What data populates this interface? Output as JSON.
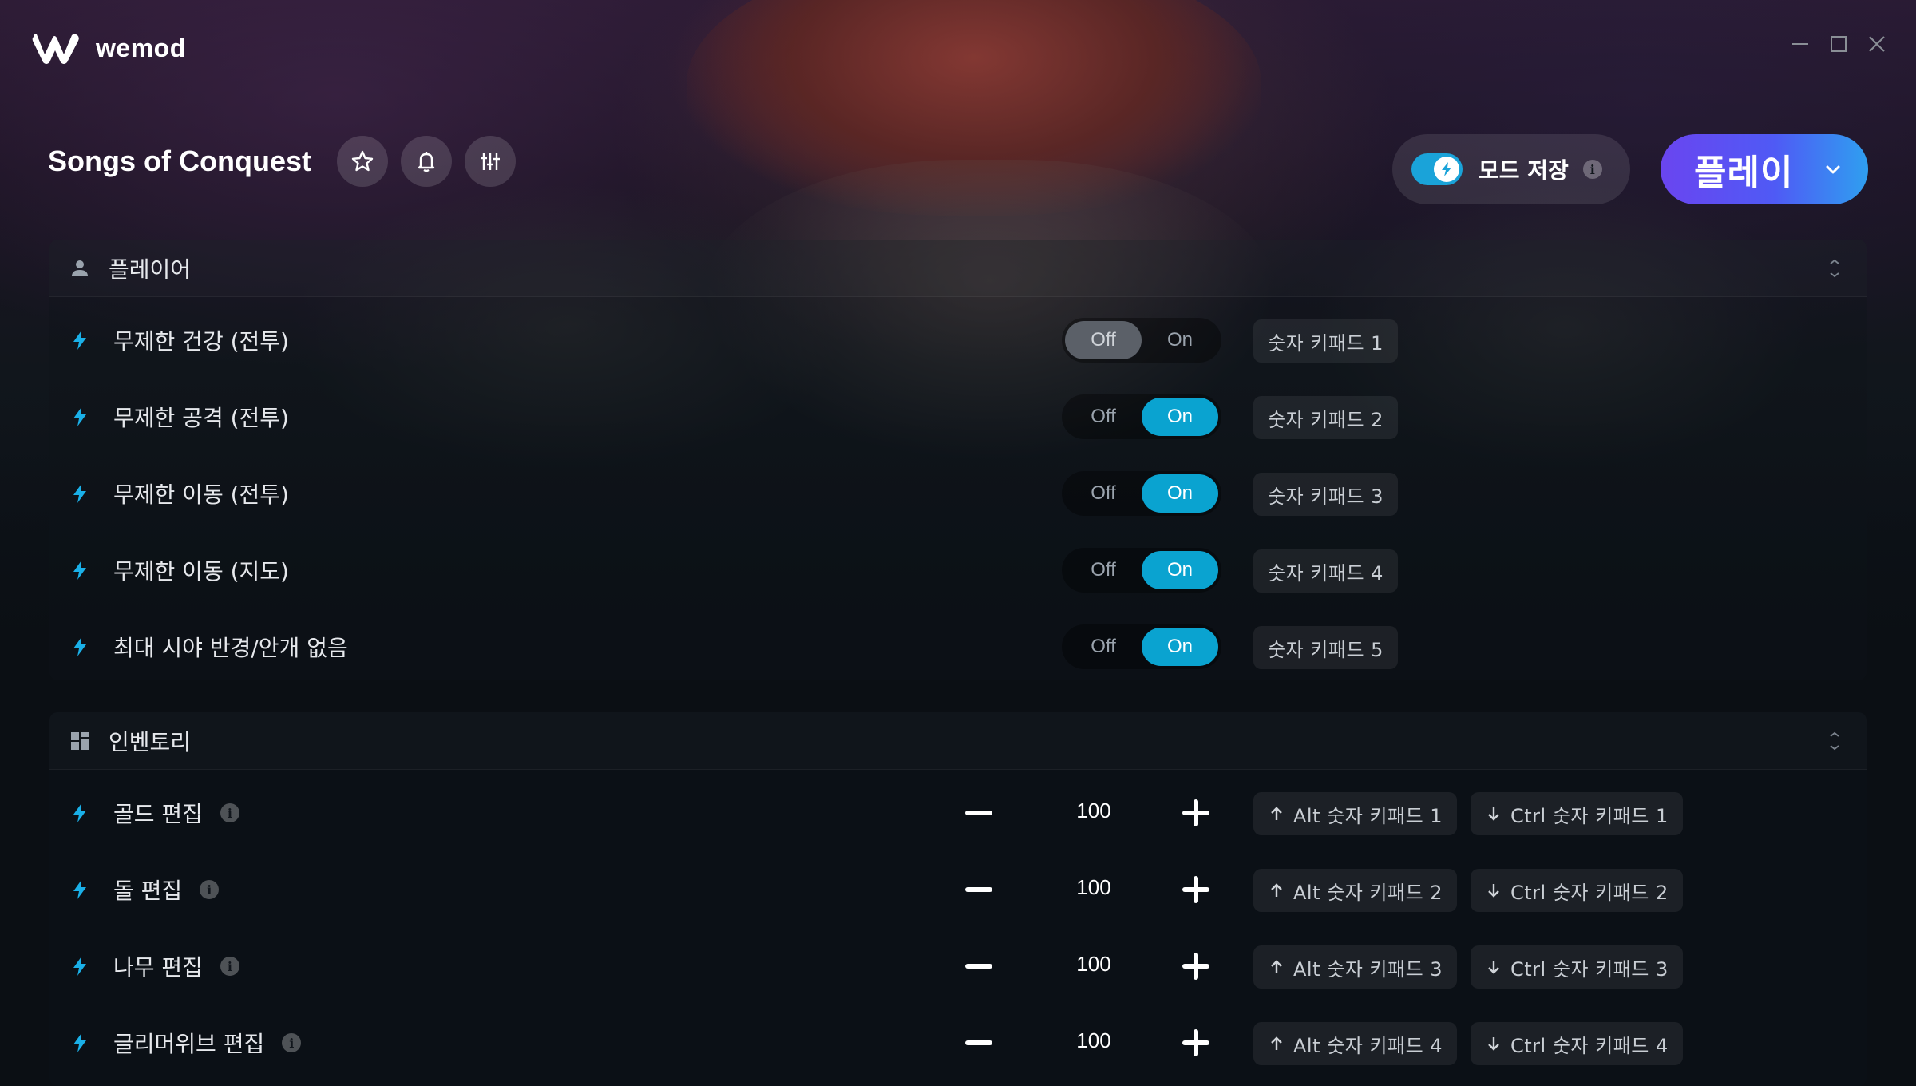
{
  "app": {
    "name": "wemod",
    "window_controls": [
      "minimize-icon",
      "maximize-icon",
      "close-icon"
    ]
  },
  "game": {
    "title": "Songs of Conquest",
    "header_buttons": [
      "star-icon",
      "bell-icon",
      "sliders-icon"
    ]
  },
  "mod_save": {
    "label": "모드 저장",
    "enabled": true,
    "info": "i"
  },
  "play": {
    "label": "플레이"
  },
  "colors": {
    "accent_on": "#0aa3d0",
    "play_gradient_start": "#6a45f0",
    "play_gradient_end": "#2f9ff0",
    "bolt": "#1ab0e8"
  },
  "sections": [
    {
      "title": "플레이어",
      "icon": "user-icon",
      "rows": [
        {
          "label": "무제한 건강 (전투)",
          "type": "toggle",
          "off": "Off",
          "on": "On",
          "state": "off",
          "hotkey": "숫자 키패드 1"
        },
        {
          "label": "무제한 공격 (전투)",
          "type": "toggle",
          "off": "Off",
          "on": "On",
          "state": "on",
          "hotkey": "숫자 키패드 2"
        },
        {
          "label": "무제한 이동 (전투)",
          "type": "toggle",
          "off": "Off",
          "on": "On",
          "state": "on",
          "hotkey": "숫자 키패드 3"
        },
        {
          "label": "무제한 이동 (지도)",
          "type": "toggle",
          "off": "Off",
          "on": "On",
          "state": "on",
          "hotkey": "숫자 키패드 4"
        },
        {
          "label": "최대 시야 반경/안개 없음",
          "type": "toggle",
          "off": "Off",
          "on": "On",
          "state": "on",
          "hotkey": "숫자 키패드 5"
        }
      ]
    },
    {
      "title": "인벤토리",
      "icon": "grid-icon",
      "rows": [
        {
          "label": "골드 편집",
          "type": "number",
          "value": "100",
          "info": "i",
          "hotkey_up": "Alt 숫자 키패드 1",
          "hotkey_down": "Ctrl 숫자 키패드 1"
        },
        {
          "label": "돌 편집",
          "type": "number",
          "value": "100",
          "info": "i",
          "hotkey_up": "Alt 숫자 키패드 2",
          "hotkey_down": "Ctrl 숫자 키패드 2"
        },
        {
          "label": "나무 편집",
          "type": "number",
          "value": "100",
          "info": "i",
          "hotkey_up": "Alt 숫자 키패드 3",
          "hotkey_down": "Ctrl 숫자 키패드 3"
        },
        {
          "label": "글리머위브 편집",
          "type": "number",
          "value": "100",
          "info": "i",
          "hotkey_up": "Alt 숫자 키패드 4",
          "hotkey_down": "Ctrl 숫자 키패드 4"
        }
      ]
    }
  ]
}
